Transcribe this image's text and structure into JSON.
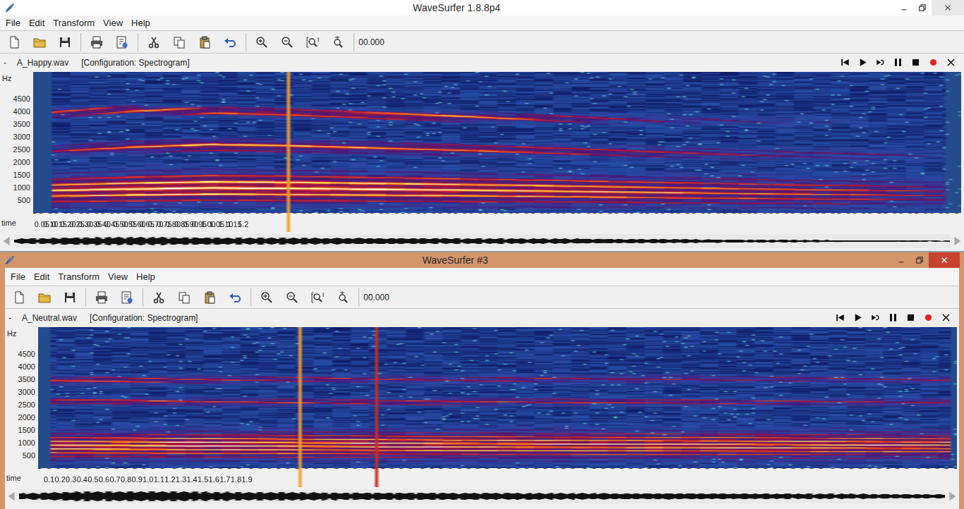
{
  "windows": [
    {
      "title": "WaveSurfer 1.8.8p4",
      "active": false,
      "menus": [
        "File",
        "Edit",
        "Transform",
        "View",
        "Help"
      ],
      "time_display": "00.000",
      "file_glyph": "-",
      "file_name": "A_Happy.wav",
      "configuration": "[Configuration: Spectrogram]",
      "hz_label": "Hz",
      "hz_ticks": [
        "4500",
        "4000",
        "3500",
        "3000",
        "2500",
        "2000",
        "1500",
        "1000",
        "500"
      ],
      "time_label": "time",
      "time_ticks": [
        "0.05",
        "0.10",
        "0.15",
        "0.20",
        "0.25",
        "0.30",
        "0.35",
        "0.40",
        "0.45",
        "0.50",
        "0.55",
        "0.60",
        "0.65",
        "0.70",
        "0.75",
        "0.80",
        "0.85",
        "0.90",
        "0.95",
        "1.00",
        "1.05",
        "1.10",
        "1.15",
        "1.2"
      ],
      "spectrogram": {
        "max_hz": 5550,
        "time_start": 0,
        "time_end": 1.21,
        "minor_step": 0.01,
        "signal_start": 0.023,
        "signal_end": 1.19,
        "pitch_hz": [
          220,
          235,
          245,
          240,
          232,
          224,
          215,
          205,
          195,
          185,
          178,
          170
        ],
        "tracks": [
          {
            "hz": [
              850,
              950,
              1000,
              980,
              950,
              920,
              890,
              860,
              830,
              800,
              780,
              760
            ],
            "bandwidth_hz": 550,
            "strength": [
              0.85,
              1.0,
              1.05,
              1.0,
              0.95,
              0.9,
              0.85,
              0.8,
              0.72,
              0.65,
              0.55,
              0.35
            ]
          },
          {
            "hz": [
              2450,
              2600,
              2650,
              2620,
              2560,
              2500,
              2450,
              2400,
              2350,
              2300,
              2280,
              2250
            ],
            "bandwidth_hz": 220,
            "strength": [
              0.45,
              0.7,
              0.8,
              0.78,
              0.72,
              0.68,
              0.6,
              0.5,
              0.42,
              0.35,
              0.3,
              0.15
            ]
          },
          {
            "hz": [
              3950,
              4050,
              4000,
              3920,
              3850,
              3780,
              3720,
              3680,
              3640,
              3600,
              3580,
              3560
            ],
            "bandwidth_hz": 170,
            "strength": [
              0.6,
              0.72,
              0.7,
              0.72,
              0.8,
              0.75,
              0.6,
              0.42,
              0.28,
              0.18,
              0.1,
              0.05
            ]
          }
        ],
        "cursors": [
          {
            "time": 0.33,
            "color": "#f0a030"
          }
        ]
      },
      "waveform": {
        "envelope": [
          0.35,
          0.55,
          0.6,
          0.55,
          0.5,
          0.48,
          0.45,
          0.42,
          0.4,
          0.38,
          0.35,
          0.3,
          0.25,
          0.2,
          0.15,
          0.1,
          0.06
        ]
      }
    },
    {
      "title": "WaveSurfer #3",
      "active": true,
      "menus": [
        "File",
        "Edit",
        "Transform",
        "View",
        "Help"
      ],
      "time_display": "00.000",
      "file_glyph": "-",
      "file_name": "A_Neutral.wav",
      "configuration": "[Configuration: Spectrogram]",
      "hz_label": "Hz",
      "hz_ticks": [
        "4500",
        "4000",
        "3500",
        "3000",
        "2500",
        "2000",
        "1500",
        "1000",
        "500"
      ],
      "time_label": "time",
      "time_ticks": [
        "0.1",
        "0.2",
        "0.3",
        "0.4",
        "0.5",
        "0.6",
        "0.7",
        "0.8",
        "0.9",
        "1.0",
        "1.1",
        "1.2",
        "1.3",
        "1.4",
        "1.5",
        "1.6",
        "1.7",
        "1.8",
        "1.9"
      ],
      "spectrogram": {
        "max_hz": 5550,
        "time_start": 0,
        "time_end": 1.926,
        "minor_step": 0.02,
        "signal_start": 0.024,
        "signal_end": 1.91,
        "pitch_hz": [
          150,
          148,
          145,
          143,
          140,
          138,
          136,
          135,
          134,
          132,
          130,
          128
        ],
        "tracks": [
          {
            "hz": [
              850,
              880,
              900,
              900,
              900,
              900,
              900,
              900,
              900,
              900,
              900,
              900
            ],
            "bandwidth_hz": 500,
            "strength": [
              0.9,
              0.95,
              0.95,
              0.92,
              0.9,
              0.9,
              0.88,
              0.88,
              0.86,
              0.85,
              0.85,
              0.82
            ]
          },
          {
            "hz": [
              2650,
              2620,
              2600,
              2600,
              2600,
              2600,
              2620,
              2620,
              2600,
              2600,
              2600,
              2600
            ],
            "bandwidth_hz": 140,
            "strength": [
              0.6,
              0.6,
              0.58,
              0.55,
              0.55,
              0.55,
              0.52,
              0.5,
              0.5,
              0.48,
              0.48,
              0.45
            ]
          },
          {
            "hz": [
              3450,
              3450,
              3480,
              3500,
              3500,
              3480,
              3500,
              3500,
              3500,
              3500,
              3500,
              3480
            ],
            "bandwidth_hz": 150,
            "strength": [
              0.65,
              0.62,
              0.5,
              0.45,
              0.45,
              0.42,
              0.42,
              0.4,
              0.4,
              0.4,
              0.4,
              0.4
            ]
          }
        ],
        "cursors": [
          {
            "time": 0.543,
            "color": "#f0a030"
          },
          {
            "time": 0.703,
            "color": "#c0302a"
          }
        ]
      },
      "waveform": {
        "envelope": [
          0.45,
          0.7,
          0.75,
          0.7,
          0.65,
          0.6,
          0.55,
          0.55,
          0.5,
          0.5,
          0.48,
          0.45,
          0.45,
          0.42,
          0.4,
          0.38,
          0.35,
          0.3
        ]
      }
    }
  ]
}
